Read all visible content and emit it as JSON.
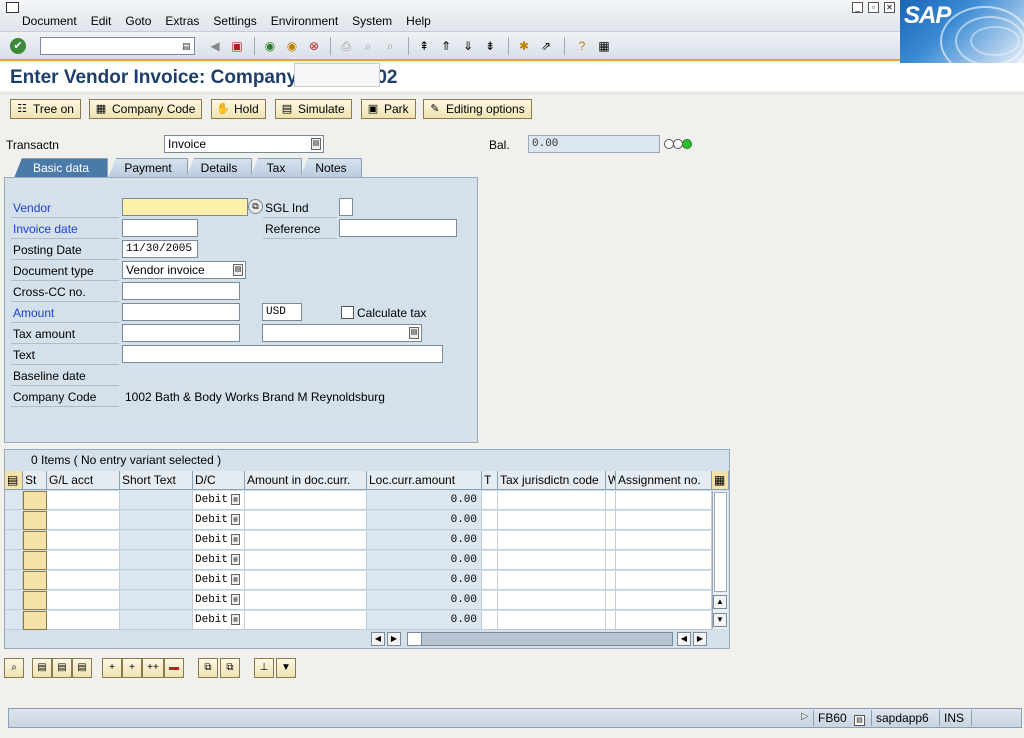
{
  "menu": {
    "items": [
      "Document",
      "Edit",
      "Goto",
      "Extras",
      "Settings",
      "Environment",
      "System",
      "Help"
    ]
  },
  "window": {
    "title": "Enter Vendor Invoice: Company Code 1002"
  },
  "logo": "SAP",
  "app_toolbar": {
    "tree_on": "Tree on",
    "company_code": "Company Code",
    "hold": "Hold",
    "simulate": "Simulate",
    "park": "Park",
    "editing_options": "Editing options"
  },
  "header": {
    "transactn_label": "Transactn",
    "transactn_value": "Invoice",
    "bal_label": "Bal.",
    "bal_value": "0.00"
  },
  "tabs": [
    "Basic data",
    "Payment",
    "Details",
    "Tax",
    "Notes"
  ],
  "basic_data": {
    "vendor_label": "Vendor",
    "vendor_value": "",
    "sgl_label": "SGL Ind",
    "invoice_date_label": "Invoice date",
    "reference_label": "Reference",
    "posting_date_label": "Posting Date",
    "posting_date_value": "11/30/2005",
    "doc_type_label": "Document type",
    "doc_type_value": "Vendor invoice",
    "cross_cc_label": "Cross-CC no.",
    "amount_label": "Amount",
    "currency_value": "USD",
    "calc_tax_label": "Calculate tax",
    "tax_amount_label": "Tax amount",
    "text_label": "Text",
    "baseline_label": "Baseline date",
    "company_code_label": "Company Code",
    "company_code_value": "1002 Bath & Body Works Brand M Reynoldsburg"
  },
  "items": {
    "summary": "0 Items ( No entry variant selected )",
    "columns": [
      "St",
      "G/L acct",
      "Short Text",
      "D/C",
      "Amount in doc.curr.",
      "Loc.curr.amount",
      "T",
      "Tax jurisdictn code",
      "W",
      "Assignment no."
    ],
    "rows": [
      {
        "dc": "Debit",
        "loc": "0.00"
      },
      {
        "dc": "Debit",
        "loc": "0.00"
      },
      {
        "dc": "Debit",
        "loc": "0.00"
      },
      {
        "dc": "Debit",
        "loc": "0.00"
      },
      {
        "dc": "Debit",
        "loc": "0.00"
      },
      {
        "dc": "Debit",
        "loc": "0.00"
      },
      {
        "dc": "Debit",
        "loc": "0.00"
      }
    ]
  },
  "status": {
    "tcode": "FB60",
    "server": "sapdapp6",
    "mode": "INS"
  },
  "colors": {
    "title": "#1d3e6a",
    "required_label": "#1f3fd0",
    "toolbar_accent": "#e4a33a",
    "active_tab": "#4a7aa8"
  }
}
